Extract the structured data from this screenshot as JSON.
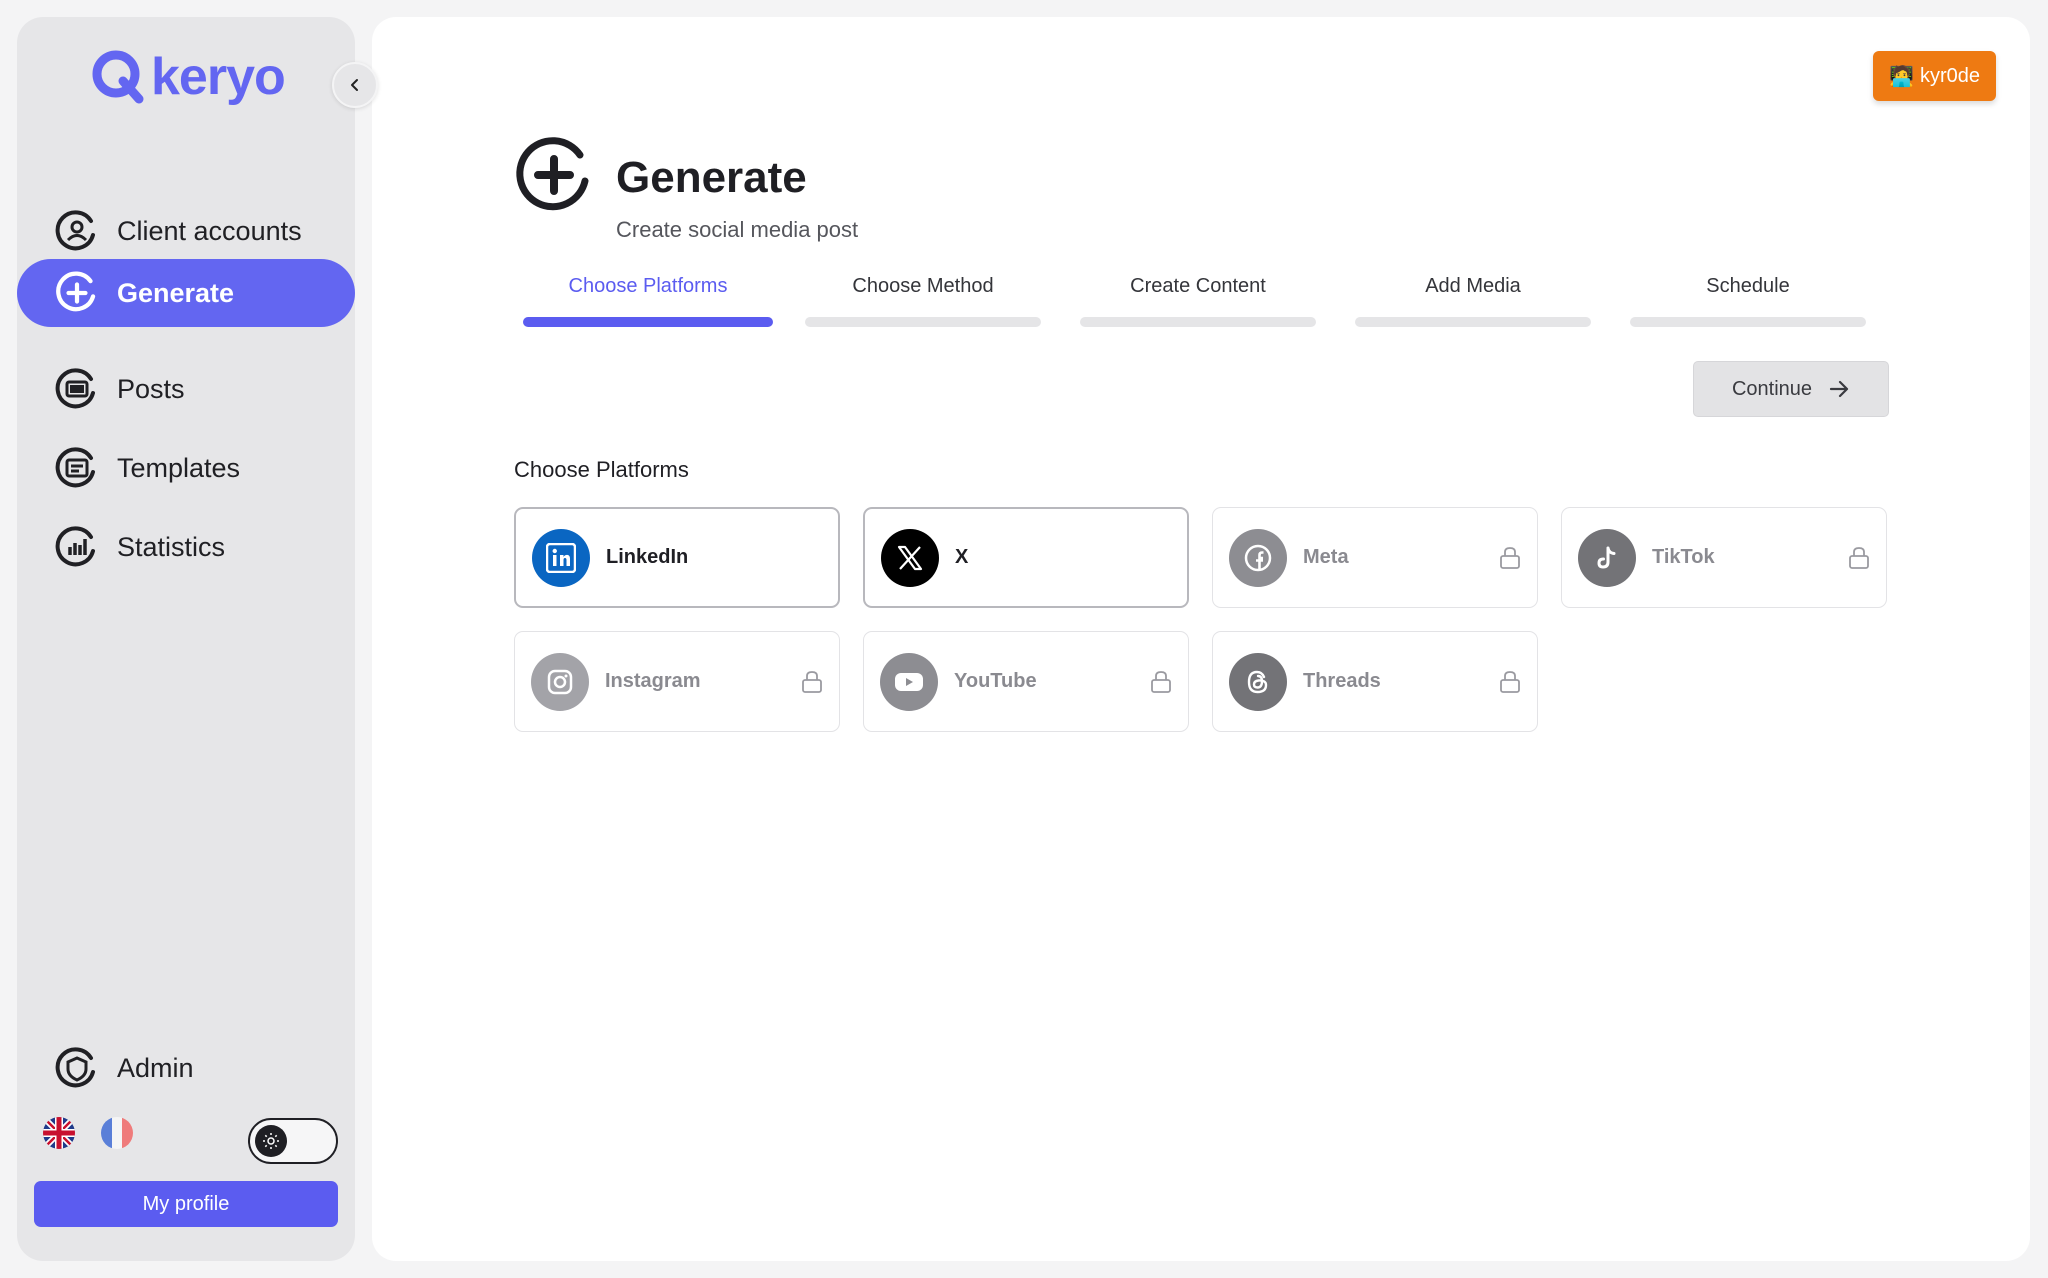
{
  "app": {
    "logo_text": "keryo"
  },
  "sidebar": {
    "items": [
      {
        "label": "Client accounts",
        "icon": "user-circle-icon"
      },
      {
        "label": "Generate",
        "icon": "plus-circle-icon",
        "active": true
      },
      {
        "label": "Posts",
        "icon": "posts-icon"
      },
      {
        "label": "Templates",
        "icon": "template-icon"
      },
      {
        "label": "Statistics",
        "icon": "bar-chart-icon"
      }
    ],
    "admin_label": "Admin",
    "languages": [
      "en",
      "fr"
    ],
    "theme": "light",
    "profile_label": "My profile"
  },
  "header": {
    "user_badge": "kyr0de",
    "user_badge_emoji": "🧑‍💻"
  },
  "page": {
    "title": "Generate",
    "subtitle": "Create social media post"
  },
  "steps": [
    {
      "label": "Choose Platforms",
      "active": true
    },
    {
      "label": "Choose Method"
    },
    {
      "label": "Create Content"
    },
    {
      "label": "Add Media"
    },
    {
      "label": "Schedule"
    }
  ],
  "continue_label": "Continue",
  "section_title": "Choose Platforms",
  "platforms": [
    {
      "name": "LinkedIn",
      "enabled": true,
      "color": "#0a66c2"
    },
    {
      "name": "X",
      "enabled": true,
      "color": "#000000"
    },
    {
      "name": "Meta",
      "enabled": false,
      "locked": true
    },
    {
      "name": "TikTok",
      "enabled": false,
      "locked": true
    },
    {
      "name": "Instagram",
      "enabled": false,
      "locked": true
    },
    {
      "name": "YouTube",
      "enabled": false,
      "locked": true
    },
    {
      "name": "Threads",
      "enabled": false,
      "locked": true
    }
  ],
  "colors": {
    "accent": "#6366f1",
    "badge": "#ee7a12",
    "disabled_icon": "#8d8d92"
  }
}
